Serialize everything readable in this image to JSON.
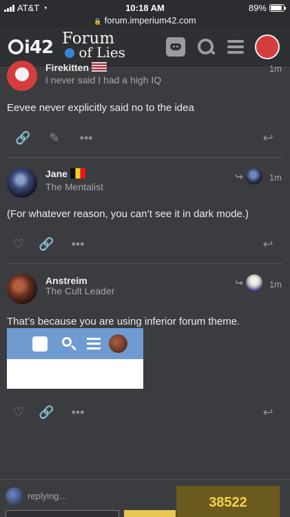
{
  "status_bar": {
    "carrier": "AT&T",
    "time": "10:18 AM",
    "battery": "89%",
    "battery_level": 0.89
  },
  "browser": {
    "url": "forum.imperium42.com"
  },
  "header": {
    "logo_text": "i42",
    "forum_logo_line1": "Forum",
    "forum_logo_line2": "of Lies"
  },
  "posts": [
    {
      "username": "Firekitten",
      "user_title": "I never said I had a high IQ",
      "time": "1m",
      "body": "Eevee never explicitly said no to the idea"
    },
    {
      "username": "Jane",
      "user_title": "The Mentalist",
      "time": "1m",
      "body": "(For whatever reason, you can’t see it in dark mode.)"
    },
    {
      "username": "Anstreim",
      "user_title": "The Cult Leader",
      "time": "1m",
      "body": "That’s because you are using inferior forum theme."
    }
  ],
  "composer": {
    "status_text": "replying…"
  },
  "counter": {
    "value": "38522"
  },
  "colors": {
    "background": "#3a3c3f",
    "header": "#2e3033",
    "accent_gold": "#f7cf4a"
  }
}
